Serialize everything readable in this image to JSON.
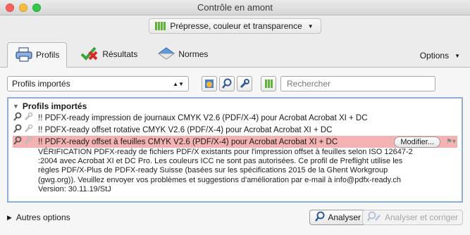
{
  "window": {
    "title": "Contrôle en amont"
  },
  "profile_selector": {
    "label": "Prépresse, couleur et transparence"
  },
  "tabs": [
    {
      "label": "Profils"
    },
    {
      "label": "Résultats"
    },
    {
      "label": "Normes"
    }
  ],
  "options": {
    "label": "Options"
  },
  "toolbar": {
    "filter_value": "Profils importés",
    "search_placeholder": "Rechercher"
  },
  "list": {
    "group_label": "Profils importés",
    "rows": [
      {
        "label": "!! PDFX-ready impression de journaux CMYK V2.6 (PDF/X-4) pour Acrobat Acrobat XI + DC"
      },
      {
        "label": "!! PDFX-ready offset rotative CMYK V2.6 (PDF/X-4) pour Acrobat Acrobat XI + DC"
      },
      {
        "label": "!! PDFX-ready offset à feuilles CMYK V2.6 (PDF/X-4) pour Acrobat Acrobat XI + DC"
      }
    ],
    "modify_label": "Modifier...",
    "description": [
      "VÉRIFICATION PDFX-ready de fichiers PDF/X existants pour l'impression offset à feuilles selon ISO 12647-2",
      ":2004 avec Acrobat XI et DC Pro. Les couleurs ICC ne sont pas autorisées. Ce profil de Preflight utilise les",
      "règles PDF/X-Plus de PDFX-ready Suisse (basées sur les spécifications 2015 de la Ghent Workgroup",
      "(gwg.org)). Veuillez envoyer vos problèmes et suggestions d'amélioration par e-mail à info@pdfx-ready.ch",
      "Version: 30.11.19/StJ"
    ]
  },
  "bottom": {
    "more_options": "Autres options",
    "analyze": "Analyser",
    "analyze_fix": "Analyser et corriger"
  },
  "colors": {
    "accent_blue": "#8eaeda",
    "selected_row": "#f4b2b2",
    "green": "#5fb435"
  }
}
